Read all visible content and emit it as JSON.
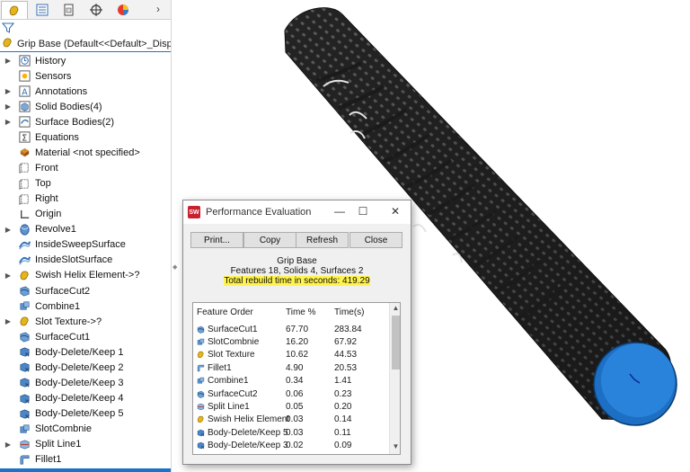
{
  "feature_manager": {
    "tabs": [
      {
        "icon": "feature-manager-icon"
      },
      {
        "icon": "property-manager-icon"
      },
      {
        "icon": "configuration-manager-icon"
      },
      {
        "icon": "dimxpert-icon"
      },
      {
        "icon": "display-manager-icon"
      }
    ],
    "root_label": "Grip Base  (Default<<Default>_Display Sta",
    "items": [
      {
        "label": "History",
        "icon": "history-icon",
        "expandable": true
      },
      {
        "label": "Sensors",
        "icon": "sensors-icon",
        "expandable": false
      },
      {
        "label": "Annotations",
        "icon": "annotations-icon",
        "expandable": true
      },
      {
        "label": "Solid Bodies(4)",
        "icon": "solid-bodies-icon",
        "expandable": true
      },
      {
        "label": "Surface Bodies(2)",
        "icon": "surface-bodies-icon",
        "expandable": true
      },
      {
        "label": "Equations",
        "icon": "equations-icon",
        "expandable": false
      },
      {
        "label": "Material <not specified>",
        "icon": "material-icon",
        "expandable": false
      },
      {
        "label": "Front",
        "icon": "plane-icon",
        "expandable": false
      },
      {
        "label": "Top",
        "icon": "plane-icon",
        "expandable": false
      },
      {
        "label": "Right",
        "icon": "plane-icon",
        "expandable": false
      },
      {
        "label": "Origin",
        "icon": "origin-icon",
        "expandable": false
      },
      {
        "label": "Revolve1",
        "icon": "revolve-icon",
        "expandable": true
      },
      {
        "label": "InsideSweepSurface",
        "icon": "sweep-surface-icon",
        "expandable": false
      },
      {
        "label": "InsideSlotSurface",
        "icon": "sweep-surface-icon",
        "expandable": false
      },
      {
        "label": "Swish Helix Element->?",
        "icon": "library-feature-icon",
        "expandable": true
      },
      {
        "label": "SurfaceCut2",
        "icon": "surface-cut-icon",
        "expandable": false
      },
      {
        "label": "Combine1",
        "icon": "combine-icon",
        "expandable": false
      },
      {
        "label": "Slot Texture->?",
        "icon": "library-feature-icon",
        "expandable": true
      },
      {
        "label": "SurfaceCut1",
        "icon": "surface-cut-icon",
        "expandable": false
      },
      {
        "label": "Body-Delete/Keep 1",
        "icon": "body-delete-icon",
        "expandable": false
      },
      {
        "label": "Body-Delete/Keep 2",
        "icon": "body-delete-icon",
        "expandable": false
      },
      {
        "label": "Body-Delete/Keep 3",
        "icon": "body-delete-icon",
        "expandable": false
      },
      {
        "label": "Body-Delete/Keep 4",
        "icon": "body-delete-icon",
        "expandable": false
      },
      {
        "label": "Body-Delete/Keep 5",
        "icon": "body-delete-icon",
        "expandable": false
      },
      {
        "label": "SlotCombnie",
        "icon": "combine-icon",
        "expandable": false
      },
      {
        "label": "Split Line1",
        "icon": "split-line-icon",
        "expandable": true
      },
      {
        "label": "Fillet1",
        "icon": "fillet-icon",
        "expandable": false
      }
    ]
  },
  "dialog": {
    "title": "Performance Evaluation",
    "buttons": {
      "print": "Print...",
      "copy": "Copy",
      "refresh": "Refresh",
      "close": "Close"
    },
    "part_name": "Grip Base",
    "summary": "Features 18, Solids 4, Surfaces 2",
    "rebuild_time": "Total rebuild time in seconds: 419.29",
    "columns": {
      "feature": "Feature Order",
      "pct": "Time %",
      "secs": "Time(s)"
    },
    "rows": [
      {
        "name": "SurfaceCut1",
        "pct": "67.70",
        "secs": "283.84",
        "icon": "surface-cut-icon"
      },
      {
        "name": "SlotCombnie",
        "pct": "16.20",
        "secs": "67.92",
        "icon": "combine-icon"
      },
      {
        "name": "Slot Texture",
        "pct": "10.62",
        "secs": "44.53",
        "icon": "library-feature-icon"
      },
      {
        "name": "Fillet1",
        "pct": "4.90",
        "secs": "20.53",
        "icon": "fillet-icon"
      },
      {
        "name": "Combine1",
        "pct": "0.34",
        "secs": "1.41",
        "icon": "combine-icon"
      },
      {
        "name": "SurfaceCut2",
        "pct": "0.06",
        "secs": "0.23",
        "icon": "surface-cut-icon"
      },
      {
        "name": "Split Line1",
        "pct": "0.05",
        "secs": "0.20",
        "icon": "split-line-icon"
      },
      {
        "name": "Swish Helix Element",
        "pct": "0.03",
        "secs": "0.14",
        "icon": "library-feature-icon"
      },
      {
        "name": "Body-Delete/Keep 5",
        "pct": "0.03",
        "secs": "0.11",
        "icon": "body-delete-icon"
      },
      {
        "name": "Body-Delete/Keep 3",
        "pct": "0.02",
        "secs": "0.09",
        "icon": "body-delete-icon"
      }
    ]
  },
  "colors": {
    "selection_blue": "#1a73c9",
    "highlight_yellow": "#fff34d",
    "grip_body": "#2a2a2a",
    "grip_end_cap": "#1f74c9",
    "icon_blue": "#2f6fb5",
    "icon_yellow": "#e0b11a"
  }
}
